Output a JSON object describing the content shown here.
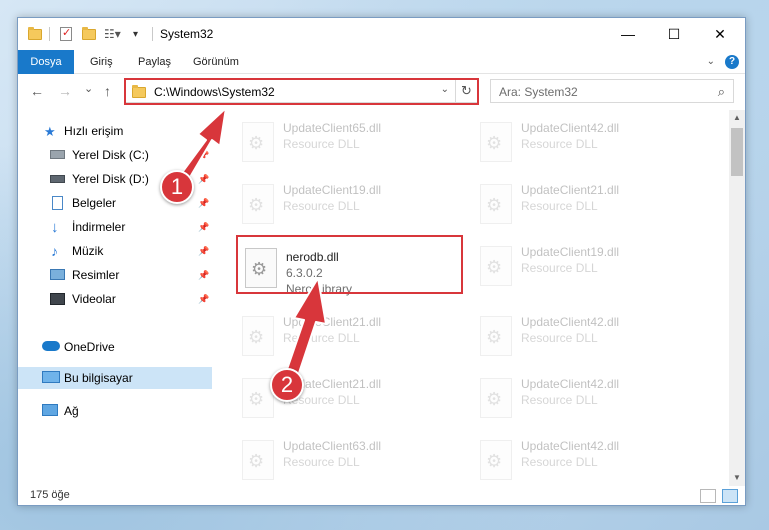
{
  "window": {
    "title": "System32",
    "controls": {
      "minimize": "—",
      "maximize": "☐",
      "close": "✕"
    }
  },
  "ribbon": {
    "tabs": [
      "Dosya",
      "Giriş",
      "Paylaş",
      "Görünüm"
    ],
    "expand_icon": "chevron-down-icon",
    "help": "?"
  },
  "nav": {
    "back": "←",
    "forward": "→",
    "recent": "⌄",
    "up": "↑",
    "address": "C:\\Windows\\System32",
    "refresh": "↻",
    "search_placeholder": "Ara: System32",
    "search_glyph": "⌕"
  },
  "sidebar": {
    "items": [
      {
        "label": "Hızlı erişim",
        "icon": "star-icon",
        "pinned": false
      },
      {
        "label": "Yerel Disk (C:)",
        "icon": "drive-icon",
        "pinned": true
      },
      {
        "label": "Yerel Disk (D:)",
        "icon": "drive-icon",
        "pinned": true
      },
      {
        "label": "Belgeler",
        "icon": "documents-icon",
        "pinned": true
      },
      {
        "label": "İndirmeler",
        "icon": "download-icon",
        "pinned": true
      },
      {
        "label": "Müzik",
        "icon": "music-icon",
        "pinned": true
      },
      {
        "label": "Resimler",
        "icon": "pictures-icon",
        "pinned": true
      },
      {
        "label": "Videolar",
        "icon": "videos-icon",
        "pinned": true
      },
      {
        "label": "OneDrive",
        "icon": "cloud-icon",
        "pinned": false
      },
      {
        "label": "Bu bilgisayar",
        "icon": "computer-icon",
        "pinned": false,
        "selected": true
      },
      {
        "label": "Ağ",
        "icon": "network-icon",
        "pinned": false
      }
    ],
    "pin_glyph": "📌"
  },
  "files": {
    "left": [
      {
        "name": "UpdateClient65.dll",
        "desc": "Resource DLL",
        "faded": true
      },
      {
        "name": "UpdateClient19.dll",
        "desc": "Resource DLL",
        "faded": true
      },
      {
        "name": "nerodb.dll",
        "desc": "6.3.0.2",
        "desc2": "Nero Library",
        "faded": false
      },
      {
        "name": "UpdateClient21.dll",
        "desc": "Resource DLL",
        "faded": true
      },
      {
        "name": "UpdateClient21.dll",
        "desc": "Resource DLL",
        "faded": true
      },
      {
        "name": "UpdateClient63.dll",
        "desc": "Resource DLL",
        "faded": true
      }
    ],
    "right": [
      {
        "name": "UpdateClient42.dll",
        "desc": "Resource DLL",
        "faded": true
      },
      {
        "name": "UpdateClient21.dll",
        "desc": "Resource DLL",
        "faded": true
      },
      {
        "name": "UpdateClient19.dll",
        "desc": "Resource DLL",
        "faded": true
      },
      {
        "name": "UpdateClient42.dll",
        "desc": "Resource DLL",
        "faded": true
      },
      {
        "name": "UpdateClient42.dll",
        "desc": "Resource DLL",
        "faded": true
      },
      {
        "name": "UpdateClient42.dll",
        "desc": "Resource DLL",
        "faded": true
      }
    ]
  },
  "status": {
    "count": "175 öğe"
  },
  "callouts": [
    "1",
    "2"
  ],
  "colors": {
    "accent": "#1979ca",
    "highlight": "#d8363b",
    "selected": "#cce4f7"
  }
}
